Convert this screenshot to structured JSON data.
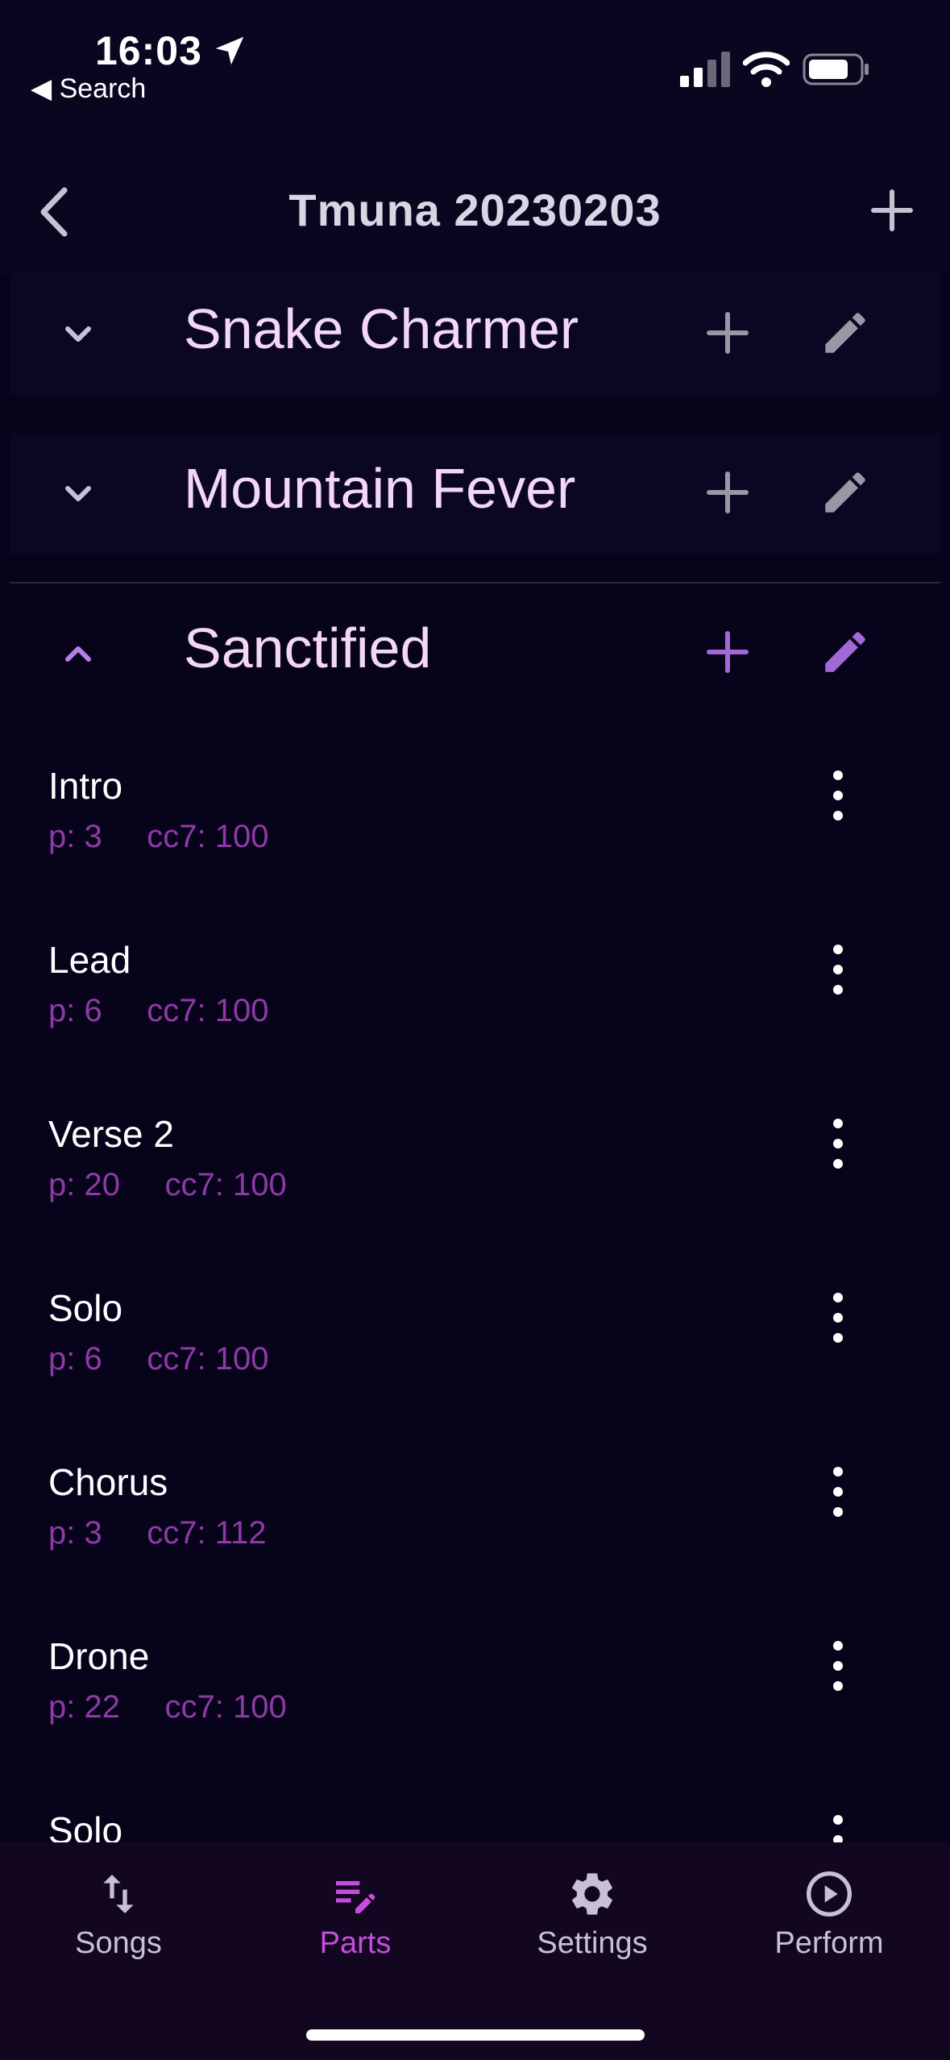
{
  "status_bar": {
    "time": "16:03",
    "back_label": "◀ Search"
  },
  "nav": {
    "title": "Tmuna 20230203"
  },
  "songs": [
    {
      "name": "Snake Charmer",
      "expanded": false
    },
    {
      "name": "Mountain Fever",
      "expanded": false
    },
    {
      "name": "Sanctified",
      "expanded": true
    }
  ],
  "parts": [
    {
      "name": "Intro",
      "meta": "p: 3     cc7: 100"
    },
    {
      "name": "Lead",
      "meta": "p: 6     cc7: 100"
    },
    {
      "name": "Verse 2",
      "meta": "p: 20     cc7: 100"
    },
    {
      "name": "Solo",
      "meta": "p: 6     cc7: 100"
    },
    {
      "name": "Chorus",
      "meta": "p: 3     cc7: 112"
    },
    {
      "name": "Drone",
      "meta": "p: 22     cc7: 100"
    },
    {
      "name": "Solo",
      "meta": ""
    }
  ],
  "tabs": [
    {
      "label": "Songs",
      "icon": "swap-vert-icon",
      "active": false
    },
    {
      "label": "Parts",
      "icon": "edit-note-icon",
      "active": true
    },
    {
      "label": "Settings",
      "icon": "gear-icon",
      "active": false
    },
    {
      "label": "Perform",
      "icon": "play-circle-icon",
      "active": false
    }
  ],
  "colors": {
    "accent": "#c84be0",
    "accent_soft": "#a06ad6",
    "meta": "#8e3aa6",
    "background": "#07031a"
  }
}
